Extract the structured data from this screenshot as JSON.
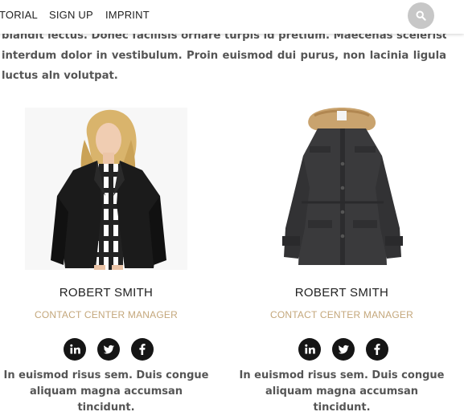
{
  "nav": {
    "items": [
      "TORIAL",
      "SIGN UP",
      "IMPRINT"
    ],
    "search_icon": "search-icon"
  },
  "intro": {
    "lines": [
      "blandit lectus. Donec facilisis ornare turpis id pretium. Maecenas scelerisque",
      "interdum dolor in vestibulum. Proin euismod dui purus, non lacinia ligula",
      "luctus aln volutpat."
    ]
  },
  "team": [
    {
      "name": "ROBERT SMITH",
      "role": "CONTACT CENTER MANAGER",
      "photo": "woman in black leather jacket and plaid shirt",
      "socials": [
        "linkedin-icon",
        "twitter-icon",
        "facebook-icon"
      ],
      "bio_lines": [
        "In euismod risus sem. Duis congue",
        "aliquam magna accumsan tincidunt."
      ]
    },
    {
      "name": "ROBERT SMITH",
      "role": "CONTACT CENTER MANAGER",
      "photo": "dark grey parka with fur hood",
      "socials": [
        "linkedin-icon",
        "twitter-icon",
        "facebook-icon"
      ],
      "bio_lines": [
        "In euismod risus sem. Duis congue",
        "aliquam magna accumsan tincidunt."
      ]
    }
  ],
  "colors": {
    "accent": "#c4a77b",
    "icon_bg": "#151515",
    "search_bg": "#c7c7c7"
  }
}
